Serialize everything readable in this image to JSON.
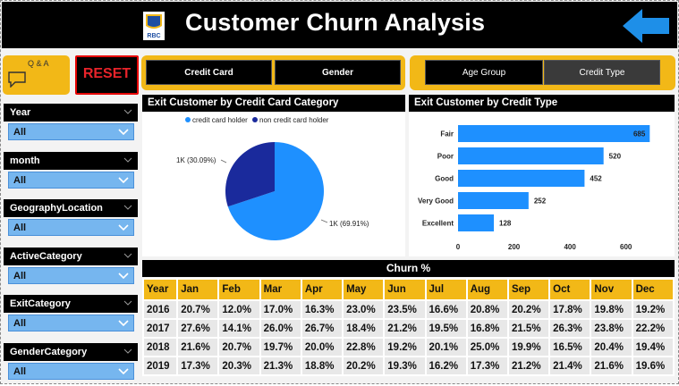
{
  "header": {
    "title": "Customer Churn Analysis",
    "logo_text": "RBC"
  },
  "actions": {
    "qa_label": "Q & A",
    "reset_label": "RESET"
  },
  "tabs_left": [
    {
      "label": "Credit Card"
    },
    {
      "label": "Gender"
    }
  ],
  "tabs_right": [
    {
      "label": "Age Group"
    },
    {
      "label": "Credit Type"
    }
  ],
  "slicers": [
    {
      "label": "Year",
      "value": "All"
    },
    {
      "label": "month",
      "value": "All"
    },
    {
      "label": "GeographyLocation",
      "value": "All"
    },
    {
      "label": "ActiveCategory",
      "value": "All"
    },
    {
      "label": "ExitCategory",
      "value": "All"
    },
    {
      "label": "GenderCategory",
      "value": "All"
    }
  ],
  "pie_panel": {
    "title": "Exit Customer by Credit Card Category",
    "legend": [
      "credit card holder",
      "non credit card holder"
    ],
    "label_right": "1K (69.91%)",
    "label_left": "1K (30.09%)"
  },
  "bar_panel": {
    "title": "Exit Customer by Credit Type"
  },
  "colors": {
    "accent": "#f2b817",
    "blue": "#1e90ff",
    "dark_blue": "#1a2a9c",
    "header": "#000000",
    "slicer": "#76b6ef"
  },
  "chart_data": [
    {
      "type": "pie",
      "title": "Exit Customer by Credit Card Category",
      "categories": [
        "credit card holder",
        "non credit card holder"
      ],
      "values": [
        69.91,
        30.09
      ],
      "labels": [
        "1K (69.91%)",
        "1K (30.09%)"
      ]
    },
    {
      "type": "bar",
      "orientation": "horizontal",
      "title": "Exit Customer by Credit Type",
      "categories": [
        "Fair",
        "Poor",
        "Good",
        "Very Good",
        "Excellent"
      ],
      "values": [
        685,
        520,
        452,
        252,
        128
      ],
      "xlim": [
        0,
        700
      ],
      "ticks": [
        "0",
        "200",
        "400",
        "600"
      ]
    }
  ],
  "churn": {
    "title": "Churn %",
    "headers": [
      "Year",
      "Jan",
      "Feb",
      "Mar",
      "Apr",
      "May",
      "Jun",
      "Jul",
      "Aug",
      "Sep",
      "Oct",
      "Nov",
      "Dec"
    ],
    "rows": [
      [
        "2016",
        "20.7%",
        "12.0%",
        "17.0%",
        "16.3%",
        "23.0%",
        "23.5%",
        "16.6%",
        "20.8%",
        "20.2%",
        "17.8%",
        "19.8%",
        "19.2%"
      ],
      [
        "2017",
        "27.6%",
        "14.1%",
        "26.0%",
        "26.7%",
        "18.4%",
        "21.2%",
        "19.5%",
        "16.8%",
        "21.5%",
        "26.3%",
        "23.8%",
        "22.2%"
      ],
      [
        "2018",
        "21.6%",
        "20.7%",
        "19.7%",
        "20.0%",
        "22.8%",
        "19.2%",
        "20.1%",
        "25.0%",
        "19.9%",
        "16.5%",
        "20.4%",
        "19.4%"
      ],
      [
        "2019",
        "17.3%",
        "20.3%",
        "21.3%",
        "18.8%",
        "20.2%",
        "19.3%",
        "16.2%",
        "17.3%",
        "21.2%",
        "21.4%",
        "21.6%",
        "19.6%"
      ]
    ]
  }
}
